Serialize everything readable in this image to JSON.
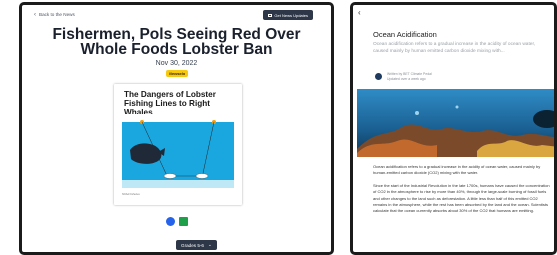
{
  "left_screen": {
    "back_label": "Back to the News",
    "news_button_label": "Get News Updates",
    "title": "Fishermen, Pols Seeing Red Over Whole Foods Lobster Ban",
    "date": "Nov 30, 2022",
    "logo_text": "Newsela",
    "infographic": {
      "title": "The Dangers of Lobster Fishing Lines to Right Whales",
      "caption": "NOAA Fisheries"
    },
    "grades_label": "Grades 5-6"
  },
  "right_screen": {
    "title": "Ocean Acidification",
    "summary": "Ocean acidification refers to a gradual increase in the acidity of ocean water, caused mainly by human emitted carbon dioxide mixing with...",
    "author": "Written by BET Climate Pedal",
    "updated": "Updated over a week ago",
    "body_paragraphs": [
      "Ocean acidification refers to a gradual increase in the acidity of ocean water, caused mainly by human-emitted carbon dioxide (CO2) mixing with the water.",
      "Since the start of the Industrial Revolution in the late 1700s, humans have caused the concentration of CO2 in the atmosphere to rise by more than 40%, through the large-scale burning of fossil fuels and other changes to the land such as deforestation. A little less than half of this emitted CO2 remains in the atmosphere, while the rest has been absorbed by the land and the ocean. Scientists calculate that the ocean currently absorbs about 30% of the CO2 that humans are emitting."
    ]
  },
  "colors": {
    "dark_button": "#2d3748",
    "ocean": "#1aa7e0",
    "brand_yellow": "#f6c90e"
  },
  "icons": [
    "chevron-left-icon",
    "newsletter-icon",
    "link-icon",
    "google-classroom-icon",
    "chevron-down-icon"
  ]
}
